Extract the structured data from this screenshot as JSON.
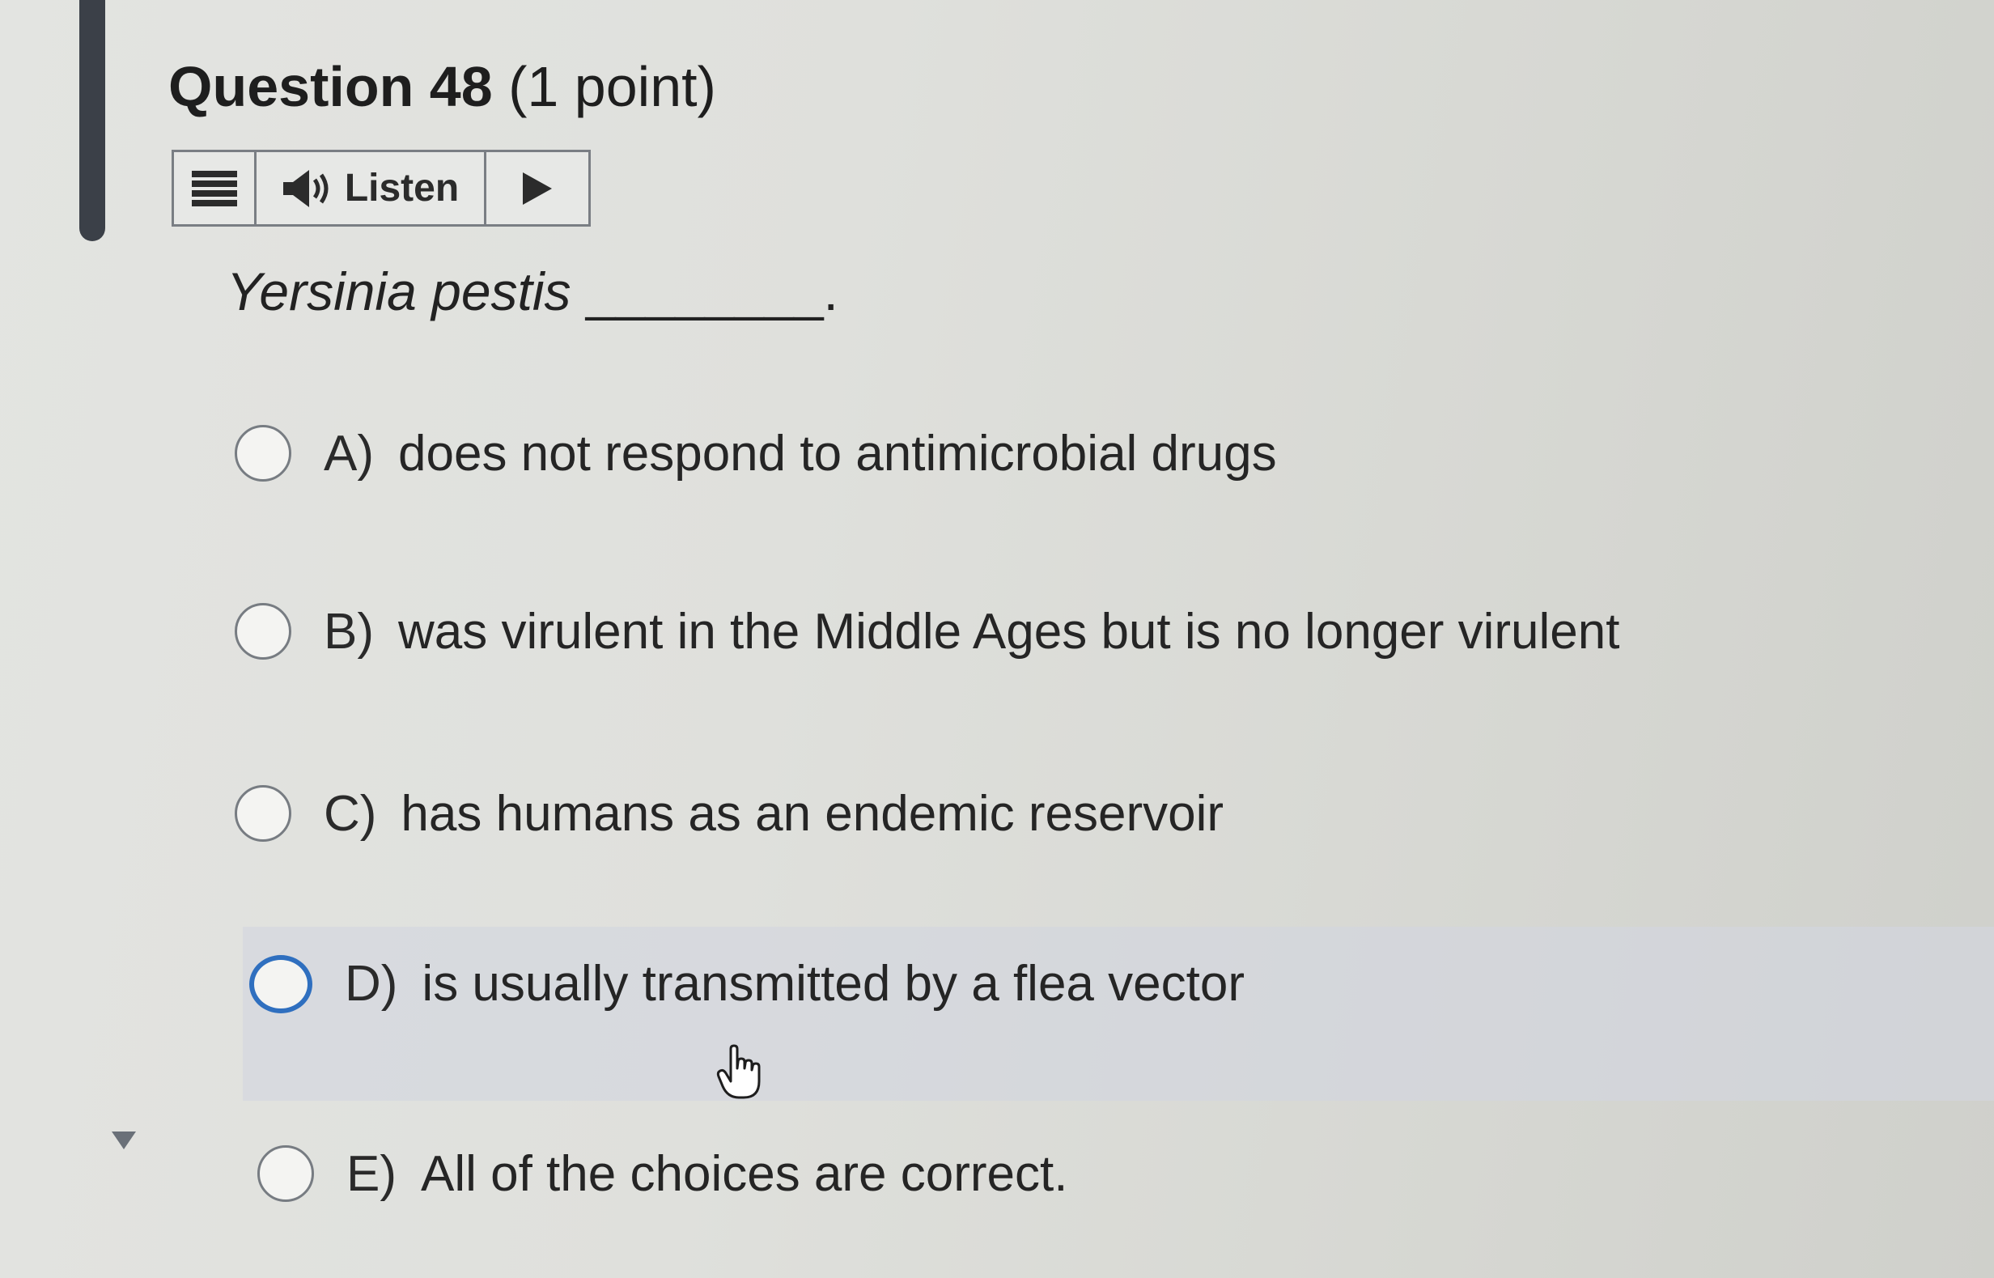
{
  "question": {
    "title_number": "Question 48",
    "title_points": "(1 point)",
    "stem_organism": "Yersinia pestis",
    "stem_blank": "________."
  },
  "readspeaker": {
    "listen_label": "Listen",
    "icons": [
      "menu-icon",
      "speaker-icon",
      "play-icon"
    ]
  },
  "options": [
    {
      "letter": "A)",
      "text": "does not respond to antimicrobial drugs"
    },
    {
      "letter": "B)",
      "text": "was virulent in the Middle Ages but is no longer virulent"
    },
    {
      "letter": "C)",
      "text": "has humans as an endemic reservoir"
    },
    {
      "letter": "D)",
      "text": "is usually transmitted by a flea vector"
    },
    {
      "letter": "E)",
      "text": "All of the choices are correct."
    }
  ],
  "colors": {
    "focus_ring": "#2f6fbf",
    "hover_row": "#d2d6de",
    "accent_bar": "#3b4048"
  }
}
